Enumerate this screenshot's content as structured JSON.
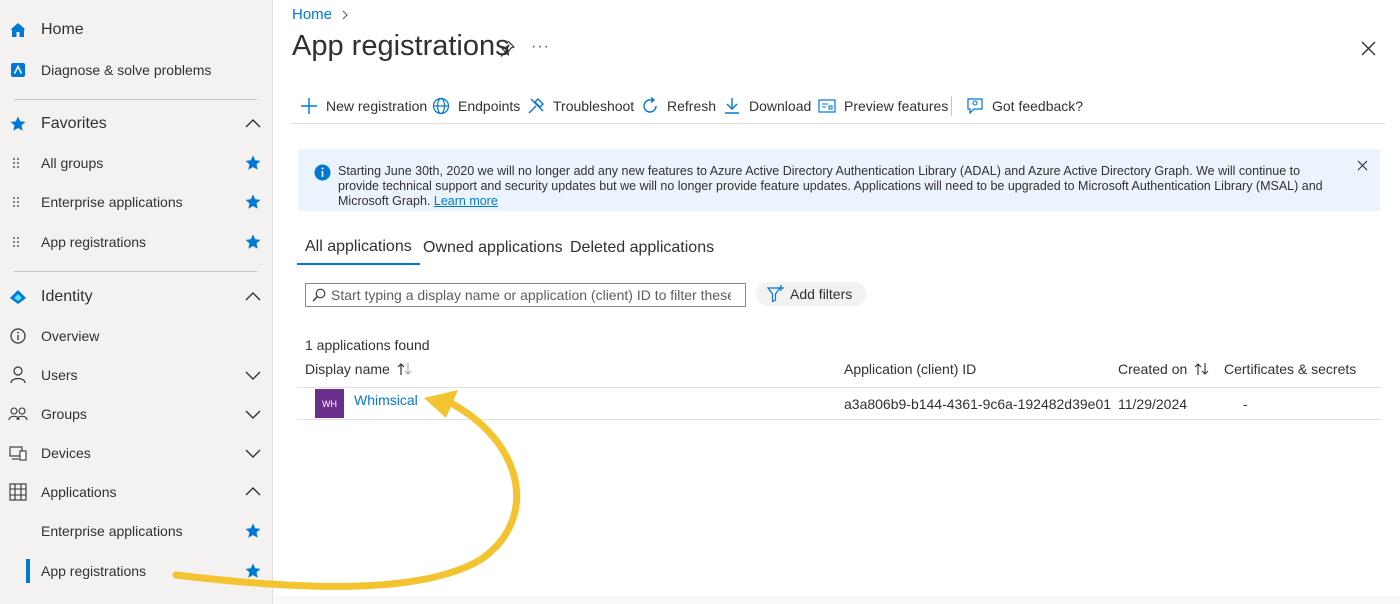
{
  "sidebar": {
    "home_label": "Home",
    "diagnose_label": "Diagnose & solve problems",
    "favorites_label": "Favorites",
    "favorites": [
      {
        "label": "All groups"
      },
      {
        "label": "Enterprise applications"
      },
      {
        "label": "App registrations"
      }
    ],
    "identity_label": "Identity",
    "identity_items": [
      {
        "label": "Overview"
      },
      {
        "label": "Users"
      },
      {
        "label": "Groups"
      },
      {
        "label": "Devices"
      },
      {
        "label": "Applications"
      }
    ],
    "applications_sub": [
      {
        "label": "Enterprise applications"
      },
      {
        "label": "App registrations"
      }
    ]
  },
  "header": {
    "breadcrumb_home": "Home",
    "title": "App registrations",
    "more": "···"
  },
  "toolbar": {
    "new_registration": "New registration",
    "endpoints": "Endpoints",
    "troubleshoot": "Troubleshoot",
    "refresh": "Refresh",
    "download": "Download",
    "preview_features": "Preview features",
    "feedback": "Got feedback?"
  },
  "banner": {
    "text": "Starting June 30th, 2020 we will no longer add any new features to Azure Active Directory Authentication Library (ADAL) and Azure Active Directory Graph. We will continue to provide technical support and security updates but we will no longer provide feature updates. Applications will need to be upgraded to Microsoft Authentication Library (MSAL) and Microsoft Graph.",
    "link": "Learn more"
  },
  "tabs": [
    {
      "label": "All applications",
      "active": true
    },
    {
      "label": "Owned applications",
      "active": false
    },
    {
      "label": "Deleted applications",
      "active": false
    }
  ],
  "search": {
    "placeholder": "Start typing a display name or application (client) ID to filter these r..."
  },
  "filters": {
    "add_label": "Add filters"
  },
  "results": {
    "count_text": "1 applications found"
  },
  "table": {
    "columns": {
      "display_name": "Display name",
      "app_id": "Application (client) ID",
      "created_on": "Created on",
      "certs": "Certificates & secrets"
    },
    "rows": [
      {
        "avatar": "WH",
        "name": "Whimsical",
        "app_id": "a3a806b9-b144-4361-9c6a-192482d39e01",
        "created_on": "11/29/2024",
        "certs": "-"
      }
    ]
  },
  "colors": {
    "accent": "#0078d4",
    "avatar": "#6b2e8f",
    "annotation_arrow": "#f4c430",
    "banner_bg": "#ebf3fc"
  }
}
